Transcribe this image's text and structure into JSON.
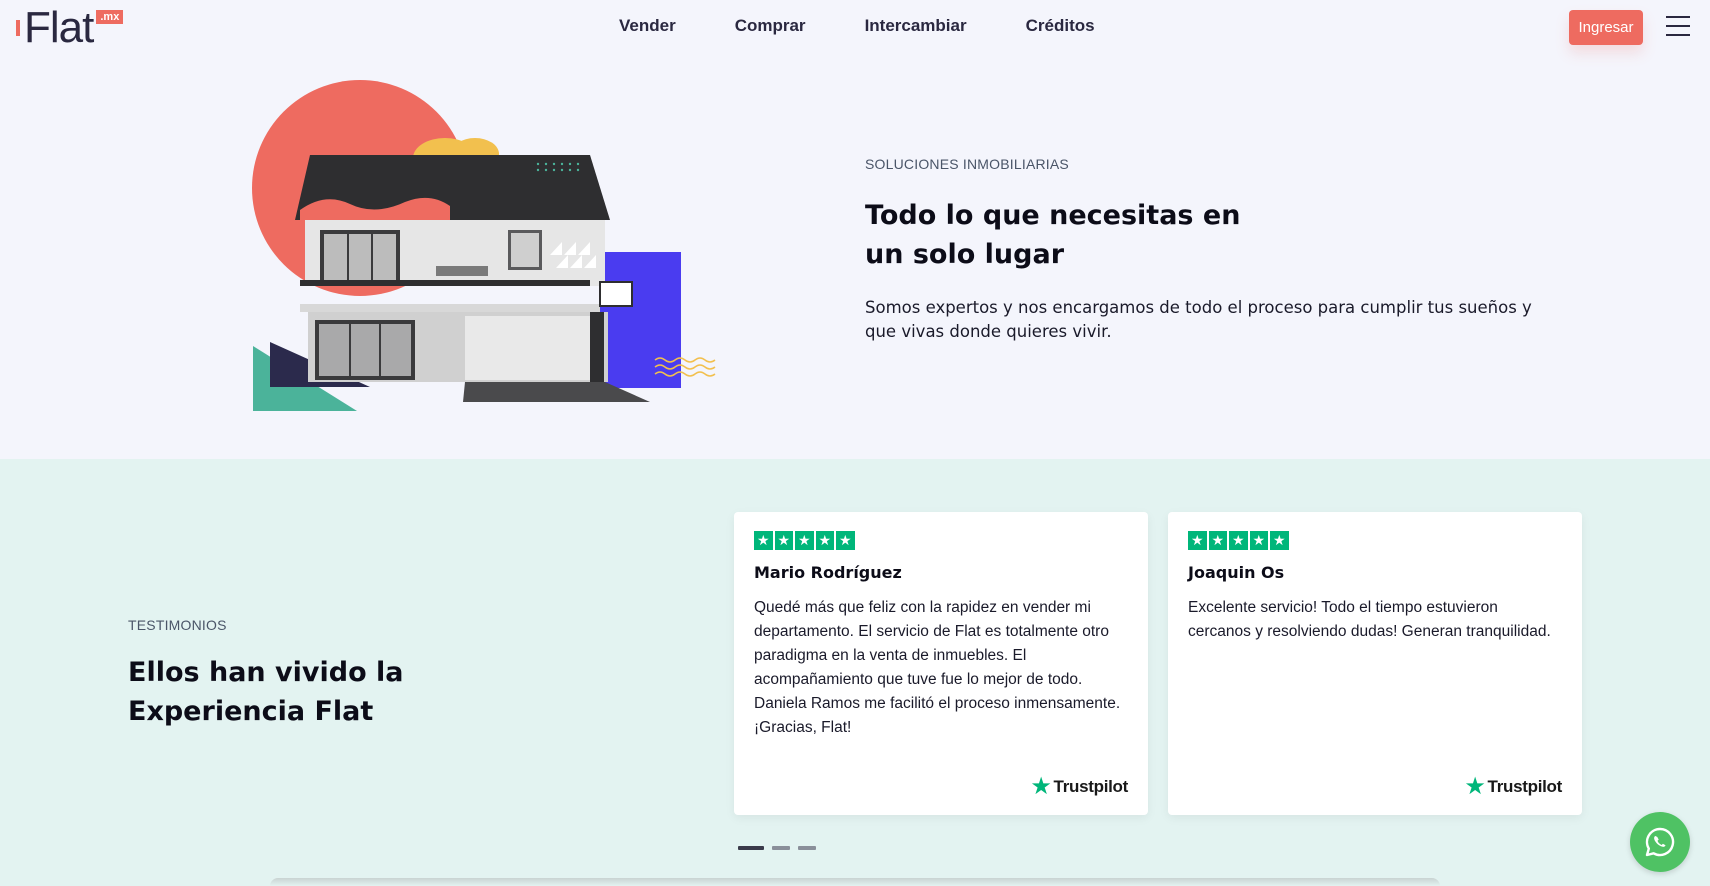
{
  "header": {
    "logo_text": "Flat",
    "logo_badge": ".mx",
    "nav": [
      "Vender",
      "Comprar",
      "Intercambiar",
      "Créditos"
    ],
    "login_label": "Ingresar",
    "menu_icon": "hamburger-icon"
  },
  "hero": {
    "eyebrow": "SOLUCIONES INMOBILIARIAS",
    "title": "Todo lo que necesitas en un solo lugar",
    "description": "Somos expertos y nos encargamos de todo el proceso para cumplir tus sueños y que vivas donde quieres vivir.",
    "colors": {
      "coral": "#ee6b60",
      "blue": "#4a3cf0",
      "teal": "#4bb39a",
      "navy": "#2b2a4c",
      "yellow": "#f2c04e"
    }
  },
  "testimonials": {
    "eyebrow": "TESTIMONIOS",
    "title": "Ellos han vivido la Experiencia Flat",
    "cards": [
      {
        "rating": 5,
        "name": "Mario Rodríguez",
        "text": "Quedé más que feliz con la rapidez en vender mi departamento. El servicio de Flat es totalmente otro paradigma en la venta de inmuebles. El acompañamiento que tuve fue lo mejor de todo. Daniela Ramos me facilitó el proceso inmensamente. ¡Gracias, Flat!",
        "source": "Trustpilot"
      },
      {
        "rating": 5,
        "name": "Joaquin Os",
        "text": "Excelente servicio! Todo el tiempo estuvieron cercanos y resolviendo dudas! Generan tranquilidad.",
        "source": "Trustpilot"
      }
    ],
    "pagination_count": 3,
    "pagination_active": 1
  },
  "whatsapp_icon": "whatsapp-icon",
  "star_icon": "star-icon"
}
